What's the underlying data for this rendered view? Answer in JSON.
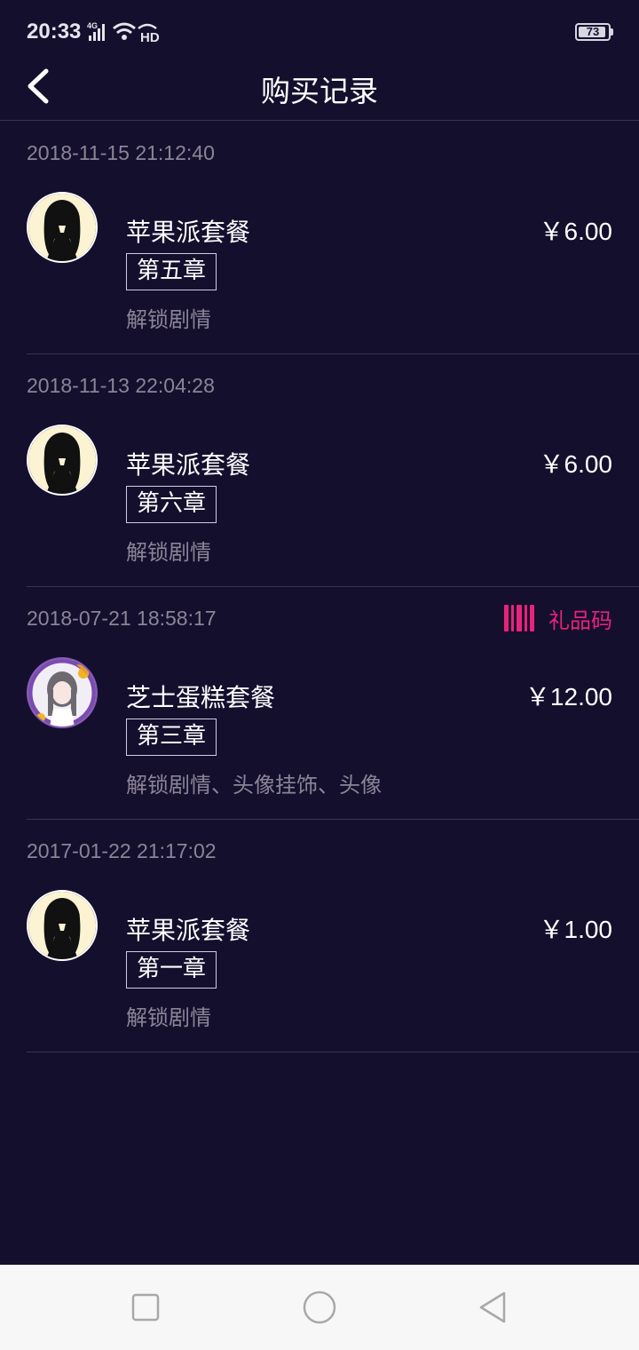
{
  "status_bar": {
    "time": "20:33",
    "network": "4G",
    "hd": "HD",
    "battery": "73"
  },
  "header": {
    "title": "购买记录",
    "back_icon": "chevron-left-icon"
  },
  "records": [
    {
      "date": "2018-11-15 21:12:40",
      "package": "苹果派套餐",
      "chapter": "第五章",
      "unlock": "解锁剧情",
      "price": "￥6.00",
      "avatar": "silhouette-girl-avatar"
    },
    {
      "date": "2018-11-13 22:04:28",
      "package": "苹果派套餐",
      "chapter": "第六章",
      "unlock": "解锁剧情",
      "price": "￥6.00",
      "avatar": "silhouette-girl-avatar"
    },
    {
      "date": "2018-07-21 18:58:17",
      "package": "芝士蛋糕套餐",
      "chapter": "第三章",
      "unlock": "解锁剧情、头像挂饰、头像",
      "price": "￥12.00",
      "avatar": "anime-girl-cake-frame-avatar",
      "gift_code": "礼品码"
    },
    {
      "date": "2017-01-22 21:17:02",
      "package": "苹果派套餐",
      "chapter": "第一章",
      "unlock": "解锁剧情",
      "price": "￥1.00",
      "avatar": "silhouette-girl-avatar"
    }
  ],
  "colors": {
    "background": "#150f2e",
    "accent": "#e8237a",
    "muted_text": "#8a8596",
    "divider": "#3a3450",
    "nav_bar": "#f7f7f7"
  },
  "nav_bar": {
    "icons": [
      "recent-apps-icon",
      "home-icon",
      "back-triangle-icon"
    ]
  }
}
